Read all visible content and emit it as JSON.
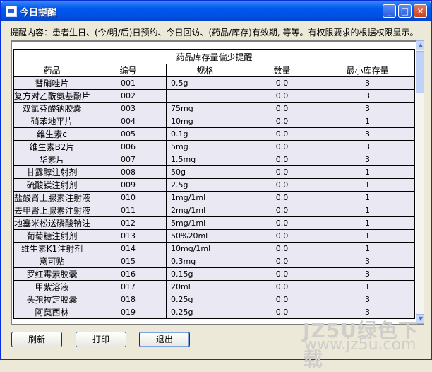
{
  "window": {
    "title": "今日提醒"
  },
  "hint": "提醒内容：患者生日、(今/明/后)日预约、今日回访、(药品/库存)有效期, 等等。有权限要求的根据权限显示。",
  "table": {
    "caption": "药品库存量偏少提醒",
    "columns": [
      "药品",
      "编号",
      "规格",
      "数量",
      "最小库存量"
    ],
    "rows": [
      [
        "替硝唑片",
        "001",
        "0.5g",
        "0.0",
        "3"
      ],
      [
        "复方对乙酰氨基酚片",
        "002",
        "",
        "0.0",
        "3"
      ],
      [
        "双氯芬酸钠胶囊",
        "003",
        "75mg",
        "0.0",
        "3"
      ],
      [
        "硝苯地平片",
        "004",
        "10mg",
        "0.0",
        "1"
      ],
      [
        "维生素c",
        "005",
        "0.1g",
        "0.0",
        "3"
      ],
      [
        "维生素B2片",
        "006",
        "5mg",
        "0.0",
        "3"
      ],
      [
        "华素片",
        "007",
        "1.5mg",
        "0.0",
        "3"
      ],
      [
        "甘露醇注射剂",
        "008",
        "50g",
        "0.0",
        "1"
      ],
      [
        "硫酸镁注射剂",
        "009",
        "2.5g",
        "0.0",
        "1"
      ],
      [
        "盐酸肾上腺素注射液",
        "010",
        "1mg/1ml",
        "0.0",
        "1"
      ],
      [
        "去甲肾上腺素注射液",
        "011",
        "2mg/1ml",
        "0.0",
        "1"
      ],
      [
        "地塞米松送磷酸钠注射液",
        "012",
        "5mg/1ml",
        "0.0",
        "1"
      ],
      [
        "葡萄糖注射剂",
        "013",
        "50%20ml",
        "0.0",
        "1"
      ],
      [
        "维生素K1注射剂",
        "014",
        "10mg/1ml",
        "0.0",
        "1"
      ],
      [
        "意可贴",
        "015",
        "0.3mg",
        "0.0",
        "3"
      ],
      [
        "罗红霉素胶囊",
        "016",
        "0.15g",
        "0.0",
        "3"
      ],
      [
        "甲紫溶液",
        "017",
        "20ml",
        "0.0",
        "1"
      ],
      [
        "头孢拉定胶囊",
        "018",
        "0.25g",
        "0.0",
        "3"
      ],
      [
        "阿莫西林",
        "019",
        "0.25g",
        "0.0",
        "3"
      ]
    ]
  },
  "buttons": {
    "refresh": "刷新",
    "print": "打印",
    "exit": "退出"
  },
  "watermark": {
    "logo": "JZ5U绿色下载",
    "url": "www.jz5u.com"
  }
}
